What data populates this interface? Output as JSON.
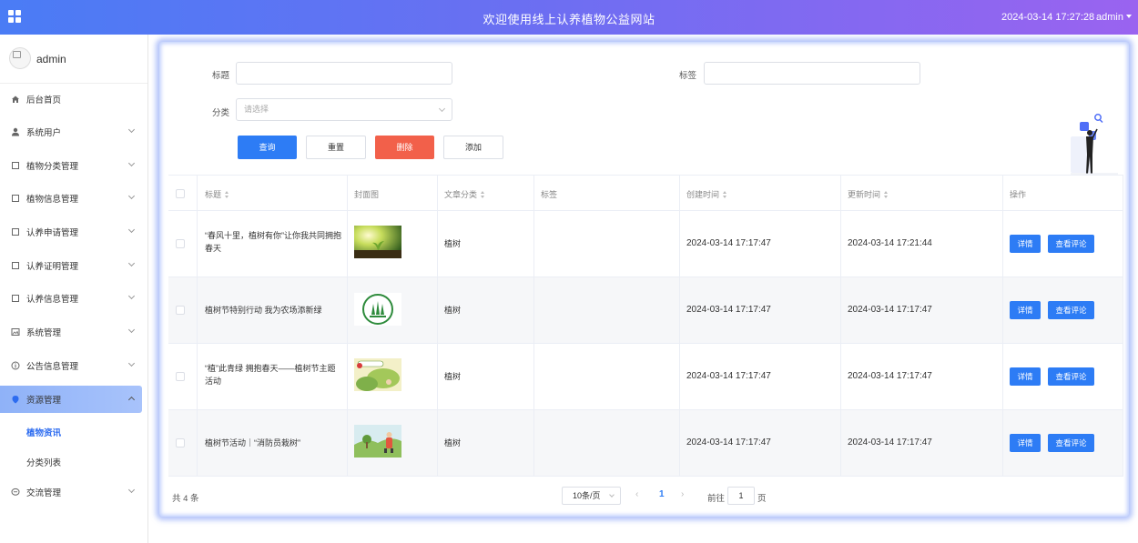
{
  "header": {
    "title": "欢迎使用线上认养植物公益网站",
    "datetime": "2024-03-14 17:27:28",
    "user": "admin"
  },
  "sidebar": {
    "username": "admin",
    "items": [
      {
        "label": "后台首页",
        "icon": "home-icon"
      },
      {
        "label": "系统用户",
        "icon": "user-icon"
      },
      {
        "label": "植物分类管理",
        "icon": "doc-icon"
      },
      {
        "label": "植物信息管理",
        "icon": "doc-icon"
      },
      {
        "label": "认养申请管理",
        "icon": "doc-icon"
      },
      {
        "label": "认养证明管理",
        "icon": "doc-icon"
      },
      {
        "label": "认养信息管理",
        "icon": "doc-icon"
      },
      {
        "label": "系统管理",
        "icon": "image-icon"
      },
      {
        "label": "公告信息管理",
        "icon": "info-icon"
      },
      {
        "label": "资源管理",
        "icon": "resource-icon"
      },
      {
        "label": "交流管理",
        "icon": "chat-icon"
      }
    ],
    "subitems": [
      {
        "label": "植物资讯"
      },
      {
        "label": "分类列表"
      }
    ]
  },
  "search": {
    "title_label": "标题",
    "tag_label": "标签",
    "category_label": "分类",
    "category_placeholder": "请选择",
    "query": "查询",
    "reset": "重置",
    "delete": "删除",
    "add": "添加"
  },
  "table": {
    "headers": {
      "title": "标题",
      "cover": "封面图",
      "category": "文章分类",
      "tags": "标签",
      "created": "创建时间",
      "updated": "更新时间",
      "actions": "操作"
    },
    "rows": [
      {
        "title": "“春风十里，植树有你”让你我共同拥抱春天",
        "category": "植树",
        "tags": "",
        "created": "2024-03-14 17:17:47",
        "updated": "2024-03-14 17:21:44"
      },
      {
        "title": "植树节特别行动 我为农场添新绿",
        "category": "植树",
        "tags": "",
        "created": "2024-03-14 17:17:47",
        "updated": "2024-03-14 17:17:47"
      },
      {
        "title": "“植”此青绿 拥抱春天——植树节主题活动",
        "category": "植树",
        "tags": "",
        "created": "2024-03-14 17:17:47",
        "updated": "2024-03-14 17:17:47"
      },
      {
        "title": "植树节活动｜“消防员栽树”",
        "category": "植树",
        "tags": "",
        "created": "2024-03-14 17:17:47",
        "updated": "2024-03-14 17:17:47"
      }
    ],
    "detail_label": "详情",
    "comments_label": "查看评论"
  },
  "pagination": {
    "total": "共 4 条",
    "page_size": "10条/页",
    "current": "1",
    "goto_label": "前往",
    "goto_value": "1",
    "unit": "页"
  },
  "colors": {
    "primary": "#2d7cf5",
    "danger": "#f2604a",
    "header_start": "#4a7cf5",
    "header_end": "#9a63f0"
  }
}
